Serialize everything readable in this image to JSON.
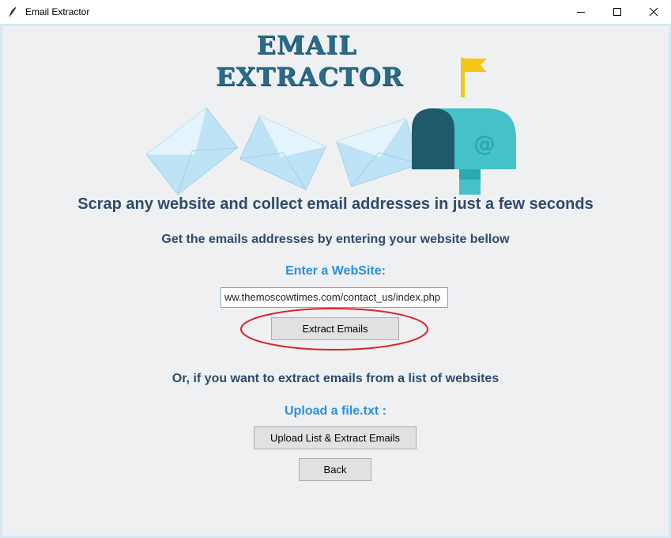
{
  "window": {
    "title": "Email Extractor",
    "app_icon": "feather-icon"
  },
  "logo": {
    "line1": "EMAIL",
    "line2": "EXTRACTOR"
  },
  "hero": {
    "mailbox_symbol": "@"
  },
  "headline": "Scrap any website and collect email addresses in just a few seconds",
  "subheadline": "Get the emails addresses by entering your website bellow",
  "website_label": "Enter a WebSite:",
  "website_input": {
    "value": "ww.themoscowtimes.com/contact_us/index.php"
  },
  "extract_button": "Extract Emails",
  "or_text": "Or, if you want to extract emails from a list of websites",
  "upload_label": "Upload a file.txt :",
  "upload_button": "Upload List & Extract Emails",
  "back_button": "Back",
  "colors": {
    "heading": "#2d4b6e",
    "accent_blue": "#2a8fd9",
    "annotation_red": "#d9262b",
    "mailbox_teal": "#45c1c8",
    "mailbox_dark": "#1f5a6b",
    "flag_yellow": "#f5c518"
  }
}
